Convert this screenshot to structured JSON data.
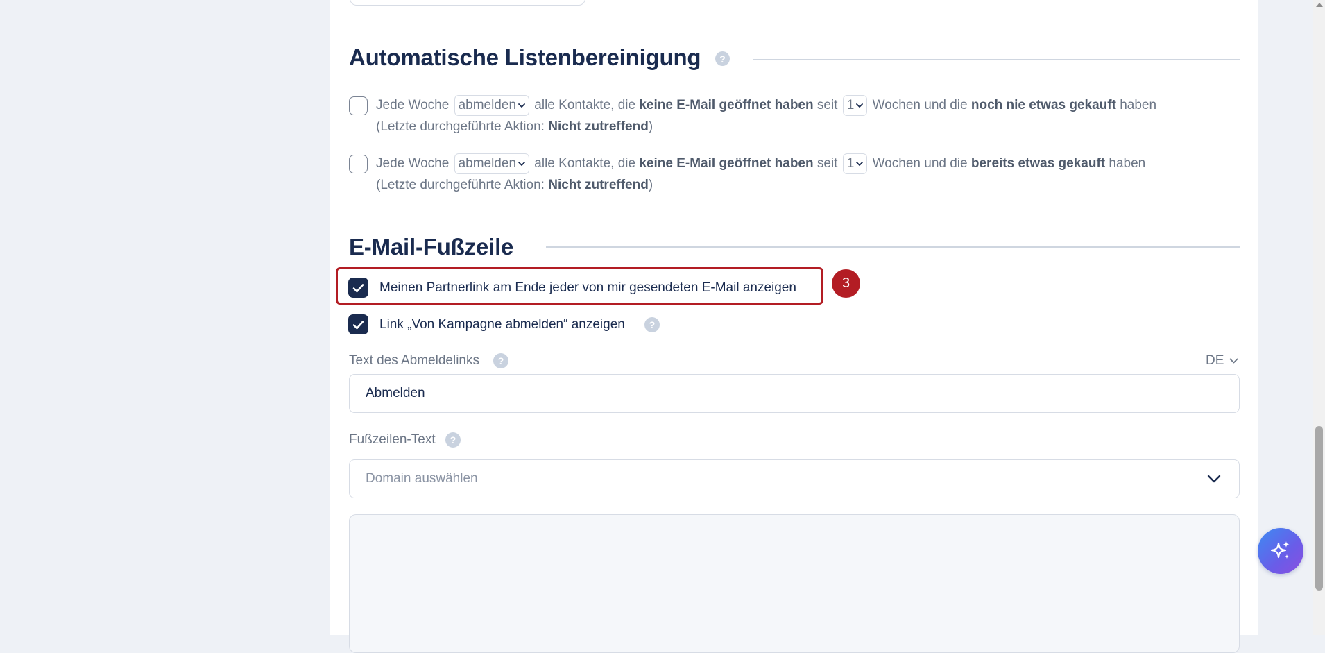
{
  "cleanup": {
    "title": "Automatische Listenbereinigung",
    "help_glyph": "?",
    "rules": [
      {
        "prefix": "Jede Woche",
        "action": "abmelden",
        "mid1": "alle Kontakte, die",
        "bold1": "keine E-Mail geöffnet haben",
        "mid2": "seit",
        "weeks": "1",
        "mid3": "Wochen und die",
        "bold2": "noch nie etwas gekauft",
        "suffix": "haben",
        "last_prefix": "(Letzte durchgeführte Aktion:",
        "last_value": "Nicht zutreffend",
        "last_suffix": ")"
      },
      {
        "prefix": "Jede Woche",
        "action": "abmelden",
        "mid1": "alle Kontakte, die",
        "bold1": "keine E-Mail geöffnet haben",
        "mid2": "seit",
        "weeks": "1",
        "mid3": "Wochen und die",
        "bold2": "bereits etwas gekauft",
        "suffix": "haben",
        "last_prefix": "(Letzte durchgeführte Aktion:",
        "last_value": "Nicht zutreffend",
        "last_suffix": ")"
      }
    ]
  },
  "footer": {
    "title": "E-Mail-Fußzeile",
    "partner_link_label": "Meinen Partnerlink am Ende jeder von mir gesendeten E-Mail anzeigen",
    "unsubscribe_link_label": "Link „Von Kampagne abmelden“ anzeigen",
    "unsubscribe_text_label": "Text des Abmeldelinks",
    "language": "DE",
    "unsubscribe_text_value": "Abmelden",
    "footer_text_label": "Fußzeilen-Text",
    "domain_placeholder": "Domain auswählen"
  },
  "annotation": {
    "step": "3"
  },
  "icons": {
    "help": "question-circle-icon",
    "check": "check-icon",
    "chevron": "chevron-down-icon",
    "assistant": "sparkle-icon"
  },
  "colors": {
    "navy": "#1a2b4f",
    "highlight_red": "#b31d24",
    "muted_text": "#6c7686"
  }
}
